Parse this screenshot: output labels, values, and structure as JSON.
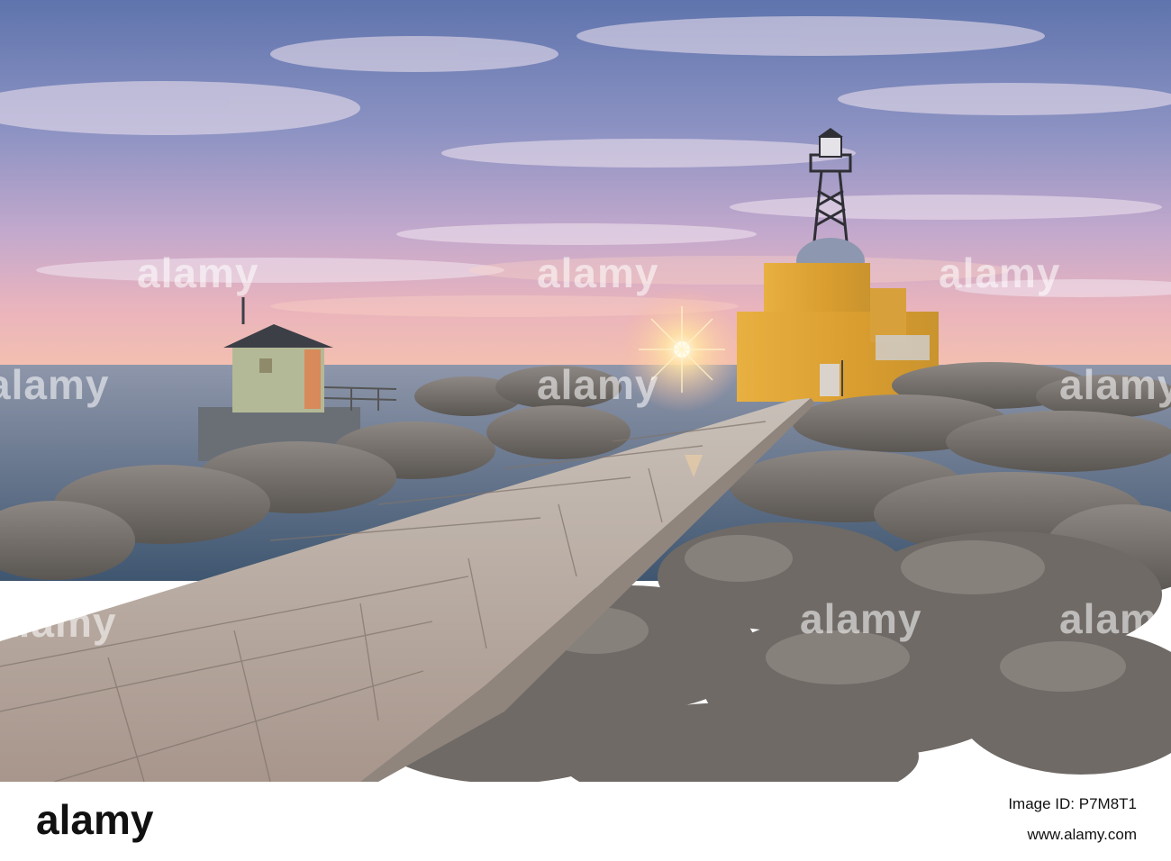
{
  "photo": {
    "description_icon": "lighthouse-sunset-photo",
    "colors": {
      "sky_top": "#6b7fb5",
      "sky_mid": "#b9a8cf",
      "sky_horizon": "#f0b7b5",
      "sun": "#fff3c8",
      "sea": "#5a6f86",
      "lighthouse": "#e2a93a",
      "hut": "#b8bf9a",
      "stone": "#7d7975",
      "path": "#b8aca2"
    }
  },
  "watermarks": [
    "alamy",
    "alamy",
    "alamy",
    "alamy",
    "alamy",
    "alamy",
    "alamy",
    "alamy",
    "alamy"
  ],
  "footer": {
    "brand": "alamy",
    "image_id_label": "Image ID:",
    "image_id": "P7M8T1",
    "site": "www.alamy.com"
  }
}
